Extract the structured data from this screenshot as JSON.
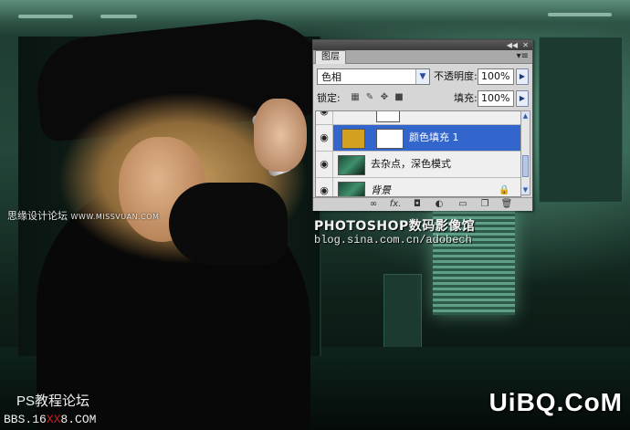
{
  "panel": {
    "tab_label": "图层",
    "menu_icon": "panel-menu-icon",
    "collapse_icon": "double-chevron-icon",
    "close_icon": "close-icon",
    "blend_mode": "色相",
    "opacity_label": "不透明度:",
    "opacity_value": "100%",
    "lock_label": "锁定:",
    "fill_label": "填充:",
    "fill_value": "100%",
    "layers": [
      {
        "name": "",
        "visible": true,
        "selected": false,
        "partial": true
      },
      {
        "name": "颜色填充 1",
        "visible": true,
        "selected": true,
        "thumb_color": "#d4a020"
      },
      {
        "name": "去杂点，深色模式",
        "visible": true,
        "selected": false
      },
      {
        "name": "背景",
        "visible": true,
        "selected": false,
        "locked": true
      }
    ],
    "footer_icons": [
      "link-icon",
      "fx-icon",
      "mask-icon",
      "adjustment-icon",
      "group-icon",
      "new-layer-icon",
      "delete-icon"
    ]
  },
  "watermarks": {
    "left_vertical": "思缘设计论坛",
    "left_url": "WWW.MISSVUAN.COM",
    "ps_title": "PHOTOSHOP数码影像馆",
    "blog": "blog.sina.com.cn/adobech",
    "forum": "PS教程论坛",
    "bbs_prefix": "BBS.16",
    "bbs_red": "XX",
    "bbs_suffix": "8.COM",
    "brand": "UiBQ.CoM"
  },
  "colors": {
    "selection": "#3266cc",
    "fill_swatch": "#d4a020",
    "teal_bg": "#23473a"
  }
}
